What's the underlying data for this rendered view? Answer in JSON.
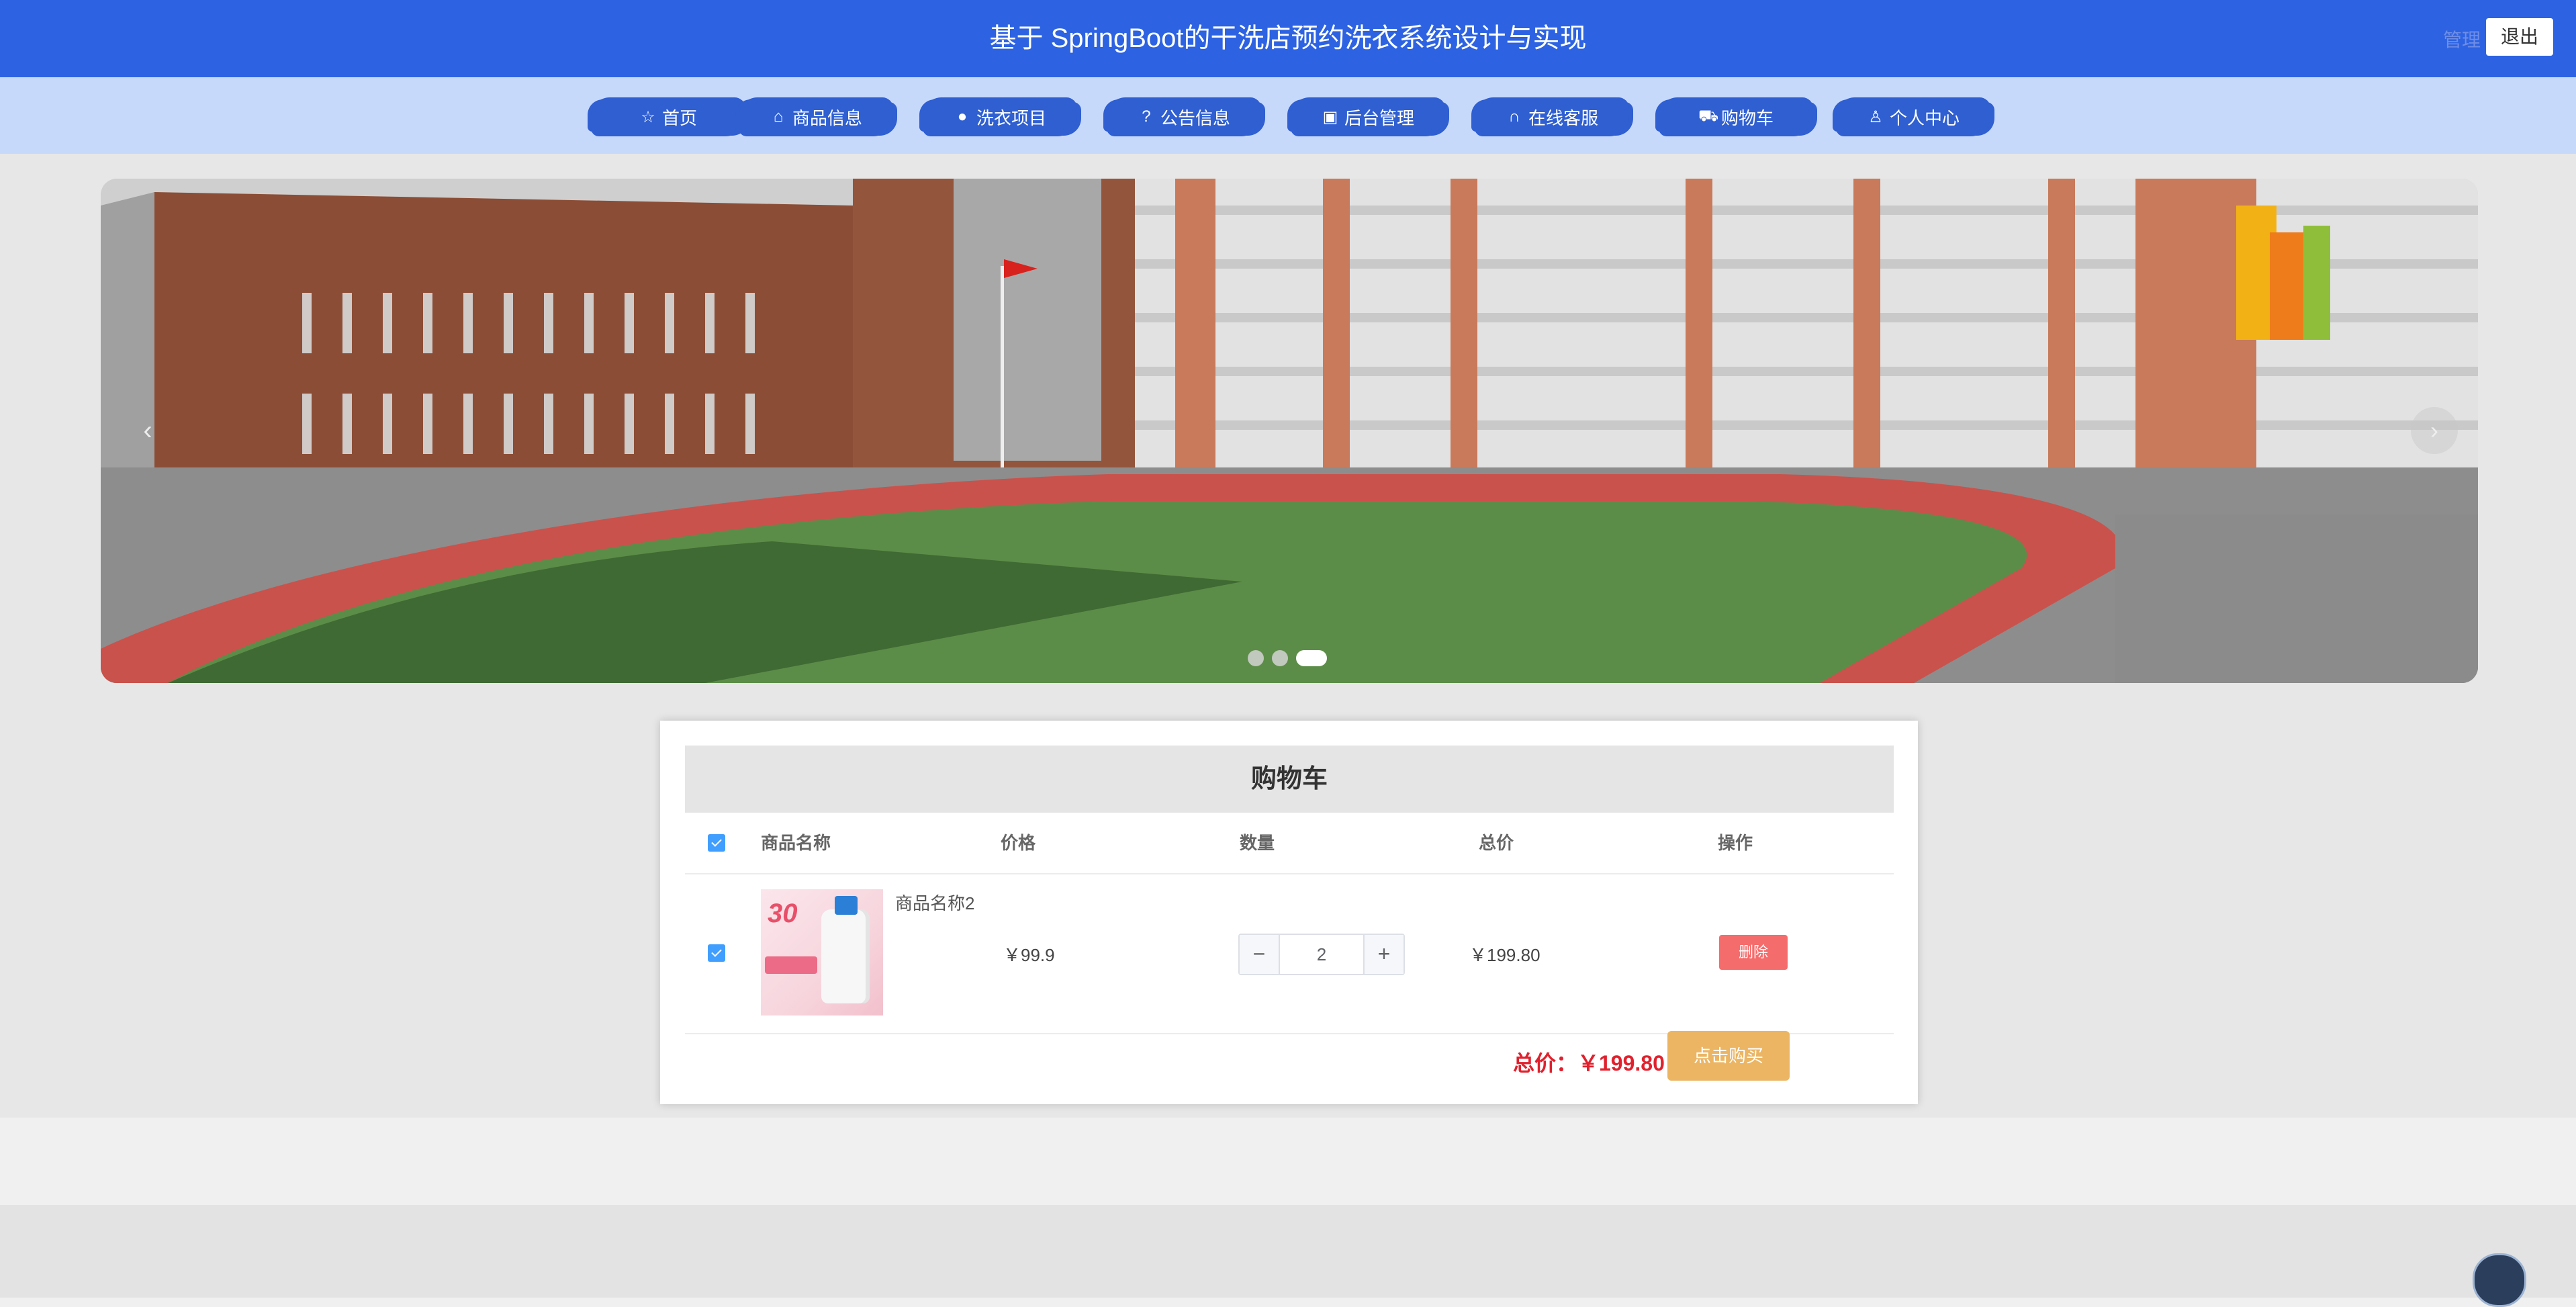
{
  "header": {
    "title": "基于 SpringBoot的干洗店预约洗衣系统设计与实现",
    "user": "管理",
    "logout_label": "退出"
  },
  "nav": {
    "items": [
      {
        "label": "首页",
        "icon": "star-icon"
      },
      {
        "label": "商品信息",
        "icon": "bag-icon"
      },
      {
        "label": "洗衣项目",
        "icon": "info-icon"
      },
      {
        "label": "公告信息",
        "icon": "question-icon"
      },
      {
        "label": "后台管理",
        "icon": "box-icon"
      },
      {
        "label": "在线客服",
        "icon": "headset-icon"
      },
      {
        "label": "购物车",
        "icon": "cart-icon"
      },
      {
        "label": "个人中心",
        "icon": "user-icon"
      }
    ]
  },
  "carousel": {
    "slide_count": 3,
    "active_index": 2
  },
  "cart": {
    "title": "购物车",
    "columns": [
      "商品名称",
      "价格",
      "数量",
      "总价",
      "操作"
    ],
    "items": [
      {
        "name": "商品名称2",
        "price": "￥99.9",
        "quantity": "2",
        "subtotal": "￥199.80",
        "delete_label": "删除",
        "thumb_badge": "30"
      }
    ],
    "total_label": "总价：￥199.80",
    "buy_label": "点击购买"
  },
  "colors": {
    "header": "#2d63e2",
    "nav_bg": "#c7d9fb",
    "nav_item": "#2f5fd1",
    "delete": "#f56c6c",
    "buy": "#ebb563",
    "total": "#e0212d"
  }
}
